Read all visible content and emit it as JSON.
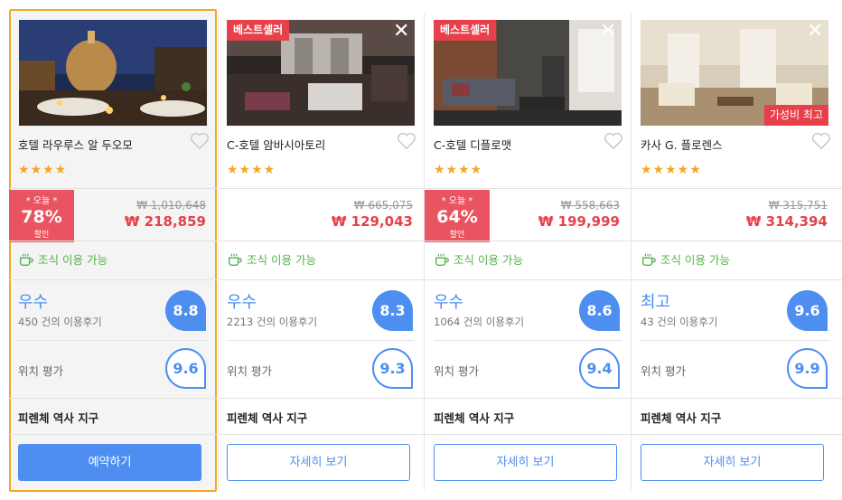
{
  "hotels": [
    {
      "name": "호텔 라우루스 알 두오모",
      "stars": "★★★★",
      "badge": "",
      "badge_br": "",
      "deal_top": "* 오늘 *",
      "deal_pct": "78%",
      "deal_bottom": "할인",
      "price_old": "₩ 1,010,648",
      "price_new": "₩ 218,859",
      "breakfast": "조식 이용 가능",
      "rating_word": "우수",
      "reviews": "450 건의 이용후기",
      "score": "8.8",
      "location_label": "위치 평가",
      "location_score": "9.6",
      "district": "피렌체 역사 지구",
      "button": "예약하기"
    },
    {
      "name": "C-호텔 암바시아토리",
      "stars": "★★★★",
      "badge": "베스트셀러",
      "badge_br": "",
      "deal_top": "",
      "deal_pct": "",
      "deal_bottom": "",
      "price_old": "₩ 665,075",
      "price_new": "₩ 129,043",
      "breakfast": "조식 이용 가능",
      "rating_word": "우수",
      "reviews": "2213 건의 이용후기",
      "score": "8.3",
      "location_label": "위치 평가",
      "location_score": "9.3",
      "district": "피렌체 역사 지구",
      "button": "자세히 보기"
    },
    {
      "name": "C-호텔 디플로맷",
      "stars": "★★★★",
      "badge": "베스트셀러",
      "badge_br": "",
      "deal_top": "* 오늘 *",
      "deal_pct": "64%",
      "deal_bottom": "할인",
      "price_old": "₩ 558,663",
      "price_new": "₩ 199,999",
      "breakfast": "조식 이용 가능",
      "rating_word": "우수",
      "reviews": "1064 건의 이용후기",
      "score": "8.6",
      "location_label": "위치 평가",
      "location_score": "9.4",
      "district": "피렌체 역사 지구",
      "button": "자세히 보기"
    },
    {
      "name": "카사 G. 플로렌스",
      "stars": "★★★★★",
      "badge": "",
      "badge_br": "가성비 최고",
      "deal_top": "",
      "deal_pct": "",
      "deal_bottom": "",
      "price_old": "₩ 315,751",
      "price_new": "₩ 314,394",
      "breakfast": "조식 이용 가능",
      "rating_word": "최고",
      "reviews": "43 건의 이용후기",
      "score": "9.6",
      "location_label": "위치 평가",
      "location_score": "9.9",
      "district": "피렌체 역사 지구",
      "button": "자세히 보기"
    }
  ],
  "colors": {
    "accent": "#4d8ef0",
    "deal": "#ea5460",
    "price": "#e8404a",
    "star": "#f5a623",
    "selected_border": "#f5a623",
    "breakfast": "#55b04b"
  },
  "icons": [
    "heart-icon",
    "coffee-cup-icon",
    "close-icon"
  ]
}
